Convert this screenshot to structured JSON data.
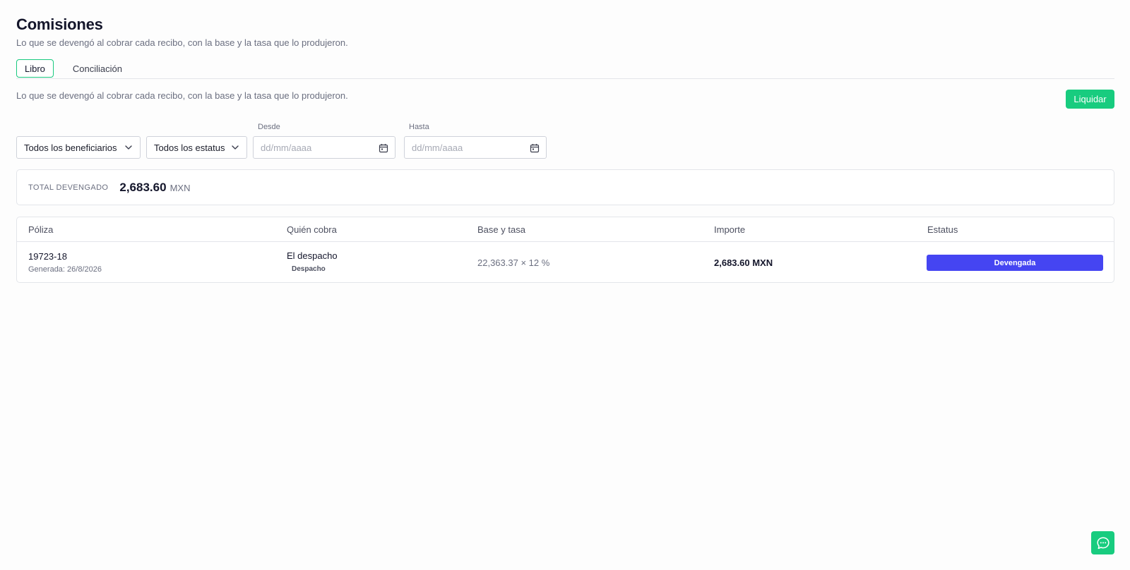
{
  "header": {
    "title": "Comisiones",
    "subtitle": "Lo que se devengó al cobrar cada recibo, con la base y la tasa que lo produjeron."
  },
  "tabs": [
    {
      "label": "Libro",
      "active": true
    },
    {
      "label": "Conciliación",
      "active": false
    }
  ],
  "section": {
    "description": "Lo que se devengó al cobrar cada recibo, con la base y la tasa que lo produjeron.",
    "liquidar_label": "Liquidar"
  },
  "filters": {
    "beneficiarios": "Todos los beneficiarios",
    "estatus": "Todos los estatus",
    "desde_label": "Desde",
    "desde_placeholder": "dd/mm/aaaa",
    "hasta_label": "Hasta",
    "hasta_placeholder": "dd/mm/aaaa"
  },
  "total": {
    "label": "Total devengado",
    "value": "2,683.60",
    "currency": "MXN"
  },
  "table": {
    "columns": [
      "Póliza",
      "Quién cobra",
      "Base y tasa",
      "Importe",
      "Estatus"
    ],
    "rows": [
      {
        "poliza": "19723-18",
        "generada": "Generada: 26/8/2026",
        "quien": "El despacho",
        "quien_tipo": "Despacho",
        "base_tasa": "22,363.37 × 12 %",
        "importe": "2,683.60 MXN",
        "estatus": "Devengada"
      }
    ]
  },
  "colors": {
    "accent": "#18cc7f",
    "status_devengada": "#4545f2"
  },
  "icons": {
    "select": "chevron-down-icon",
    "date": "calendar-icon",
    "chat": "chat-icon"
  }
}
